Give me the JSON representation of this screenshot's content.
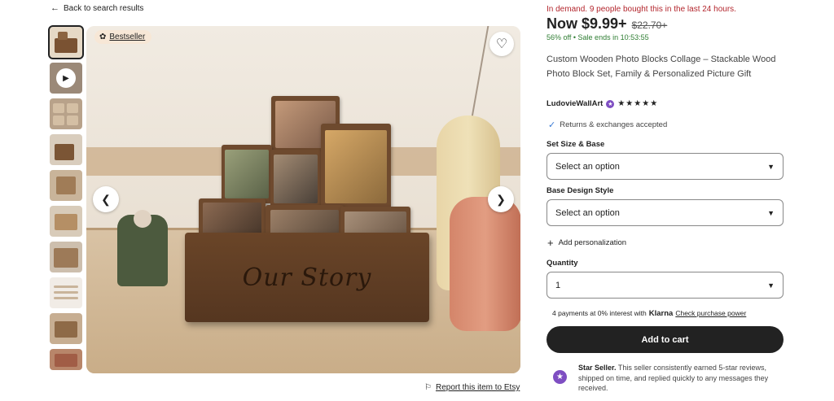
{
  "nav": {
    "back_label": "Back to search results"
  },
  "gallery": {
    "bestseller_label": "Bestseller",
    "report_label": "Report this item to Etsy",
    "thumbnail_count": 10
  },
  "product": {
    "demand_text": "In demand. 9 people bought this in the last 24 hours.",
    "price_now": "Now $9.99+",
    "price_original": "$22.70+",
    "discount": "56% off",
    "sale_separator": "•",
    "sale_ends": "Sale ends in 10:53:55",
    "title": "Custom Wooden Photo Blocks Collage – Stackable Wood Photo Block Set, Family & Personalized Picture Gift",
    "shop_name": "LudovieWallArt",
    "rating_stars": "★★★★★",
    "returns_text": "Returns & exchanges accepted"
  },
  "options": {
    "size_label": "Set Size & Base",
    "size_value": "Select an option",
    "design_label": "Base Design Style",
    "design_value": "Select an option",
    "personalization_label": "Add personalization",
    "quantity_label": "Quantity",
    "quantity_value": "1"
  },
  "payment": {
    "klarna_prefix": "4 payments at 0% interest with",
    "klarna_brand": "Klarna",
    "klarna_link": "Check purchase power"
  },
  "cart": {
    "add_to_cart_label": "Add to cart"
  },
  "star_seller": {
    "title": "Star Seller.",
    "description": "This seller consistently earned 5-star reviews, shipped on time, and replied quickly to any messages they received."
  },
  "colors": {
    "demand_red": "#b3262d",
    "sale_green": "#2e7d32",
    "star_seller_purple": "#7e4ec2",
    "cart_button": "#222222"
  },
  "base_engraving": "Our Story"
}
